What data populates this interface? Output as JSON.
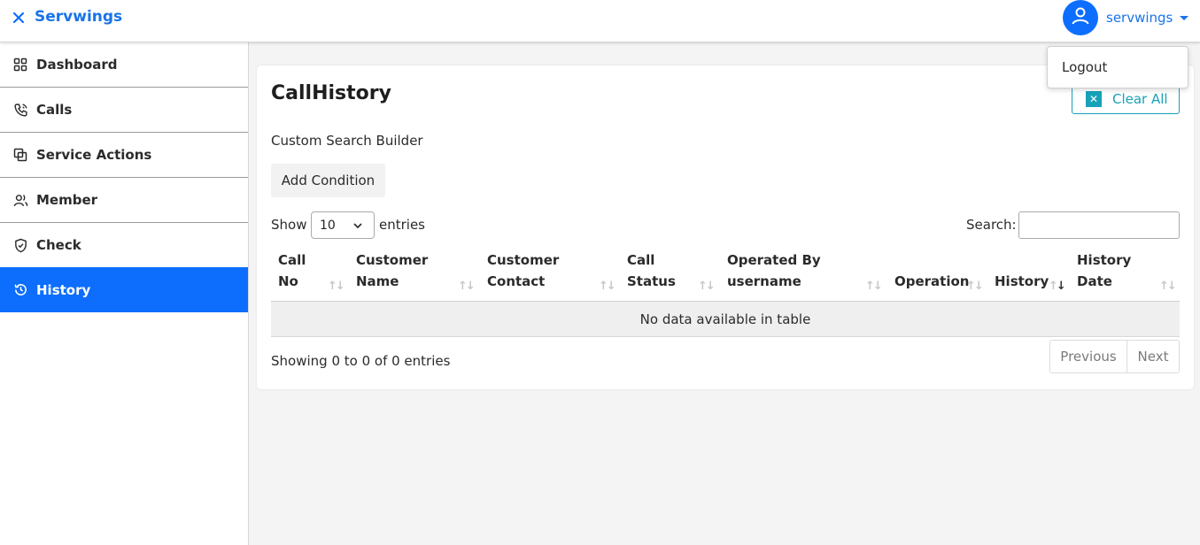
{
  "header": {
    "brand": "Servwings",
    "username": "servwings",
    "close_icon": "close-icon",
    "avatar_icon": "user-icon",
    "accent": "#0d6efd"
  },
  "user_menu": {
    "items": [
      {
        "label": "Logout"
      }
    ]
  },
  "sidebar": {
    "items": [
      {
        "label": "Dashboard",
        "icon": "grid-icon",
        "active": false
      },
      {
        "label": "Calls",
        "icon": "phone-icon",
        "active": false
      },
      {
        "label": "Service Actions",
        "icon": "copy-icon",
        "active": false
      },
      {
        "label": "Member",
        "icon": "users-icon",
        "active": false
      },
      {
        "label": "Check",
        "icon": "shield-check-icon",
        "active": false
      },
      {
        "label": "History",
        "icon": "history-icon",
        "active": true
      }
    ]
  },
  "main": {
    "title": "CallHistory",
    "clear_all_label": "Clear All",
    "search_builder_label": "Custom Search Builder",
    "add_condition_label": "Add Condition",
    "length": {
      "show": "Show",
      "value": "10",
      "entries": "entries"
    },
    "search_label": "Search:",
    "search_value": "",
    "table": {
      "columns": [
        {
          "label": "Call\nNo",
          "sorted": false
        },
        {
          "label": "Customer\nName",
          "sorted": false
        },
        {
          "label": "Customer\nContact",
          "sorted": false
        },
        {
          "label": "Call\nStatus",
          "sorted": false
        },
        {
          "label": "Operated By\nusername",
          "sorted": false
        },
        {
          "label": "Operation",
          "sorted": false
        },
        {
          "label": "History",
          "sorted": true
        },
        {
          "label": "History\nDate",
          "sorted": false
        }
      ],
      "empty_message": "No data available in table"
    },
    "info": "Showing 0 to 0 of 0 entries",
    "pagination": {
      "previous": "Previous",
      "next": "Next"
    }
  }
}
